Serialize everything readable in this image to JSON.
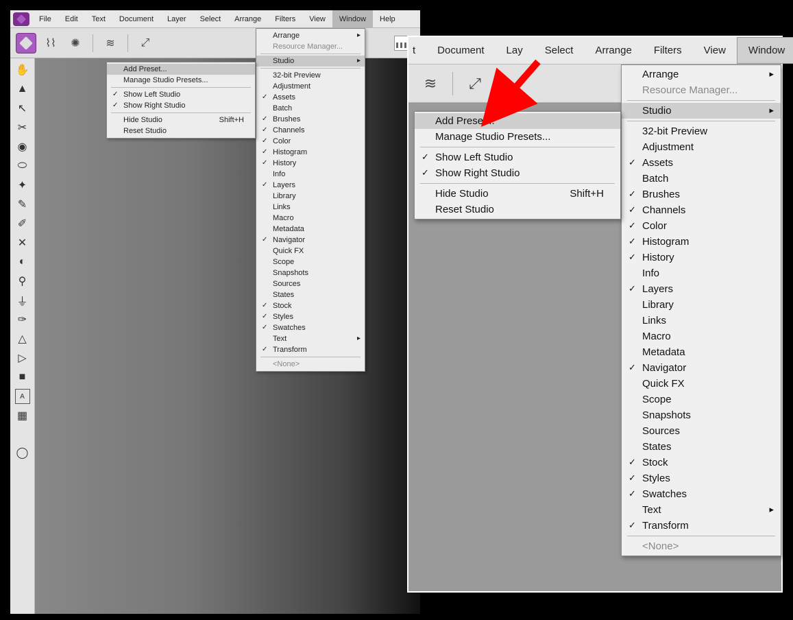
{
  "menubar": [
    "File",
    "Edit",
    "Text",
    "Document",
    "Layer",
    "Select",
    "Arrange",
    "Filters",
    "View",
    "Window",
    "Help"
  ],
  "menubar_active": "Window",
  "window_menu": {
    "top": [
      {
        "label": "Arrange",
        "arrow": true
      },
      {
        "label": "Resource Manager...",
        "disabled": true
      }
    ],
    "studio_label": "Studio",
    "studio_sub": [
      {
        "label": "Add Preset...",
        "hl": true
      },
      {
        "label": "Manage Studio Presets..."
      },
      {
        "sep": true
      },
      {
        "label": "Show Left Studio",
        "check": true
      },
      {
        "label": "Show Right Studio",
        "check": true
      },
      {
        "sep": true
      },
      {
        "label": "Hide Studio",
        "shortcut": "Shift+H"
      },
      {
        "label": "Reset Studio"
      }
    ],
    "panels": [
      {
        "label": "32-bit Preview"
      },
      {
        "label": "Adjustment"
      },
      {
        "label": "Assets",
        "check": true
      },
      {
        "label": "Batch"
      },
      {
        "label": "Brushes",
        "check": true
      },
      {
        "label": "Channels",
        "check": true
      },
      {
        "label": "Color",
        "check": true
      },
      {
        "label": "Histogram",
        "check": true
      },
      {
        "label": "History",
        "check": true
      },
      {
        "label": "Info"
      },
      {
        "label": "Layers",
        "check": true
      },
      {
        "label": "Library"
      },
      {
        "label": "Links"
      },
      {
        "label": "Macro"
      },
      {
        "label": "Metadata"
      },
      {
        "label": "Navigator",
        "check": true
      },
      {
        "label": "Quick FX"
      },
      {
        "label": "Scope"
      },
      {
        "label": "Snapshots"
      },
      {
        "label": "Sources"
      },
      {
        "label": "States"
      },
      {
        "label": "Stock",
        "check": true
      },
      {
        "label": "Styles",
        "check": true
      },
      {
        "label": "Swatches",
        "check": true
      },
      {
        "label": "Text",
        "arrow": true
      },
      {
        "label": "Transform",
        "check": true
      }
    ],
    "none_label": "<None>"
  },
  "zoom_menubar_fragments": [
    "t",
    "Document",
    "Lay",
    "Select",
    "Arrange",
    "Filters",
    "View",
    "Window"
  ],
  "tools": [
    "hand",
    "move",
    "node",
    "crop",
    "flood",
    "clone",
    "heal",
    "paint",
    "erase",
    "dodge",
    "picker",
    "stamp",
    "brush",
    "pen",
    "shape",
    "pencil",
    "rect",
    "text",
    "mesh"
  ]
}
